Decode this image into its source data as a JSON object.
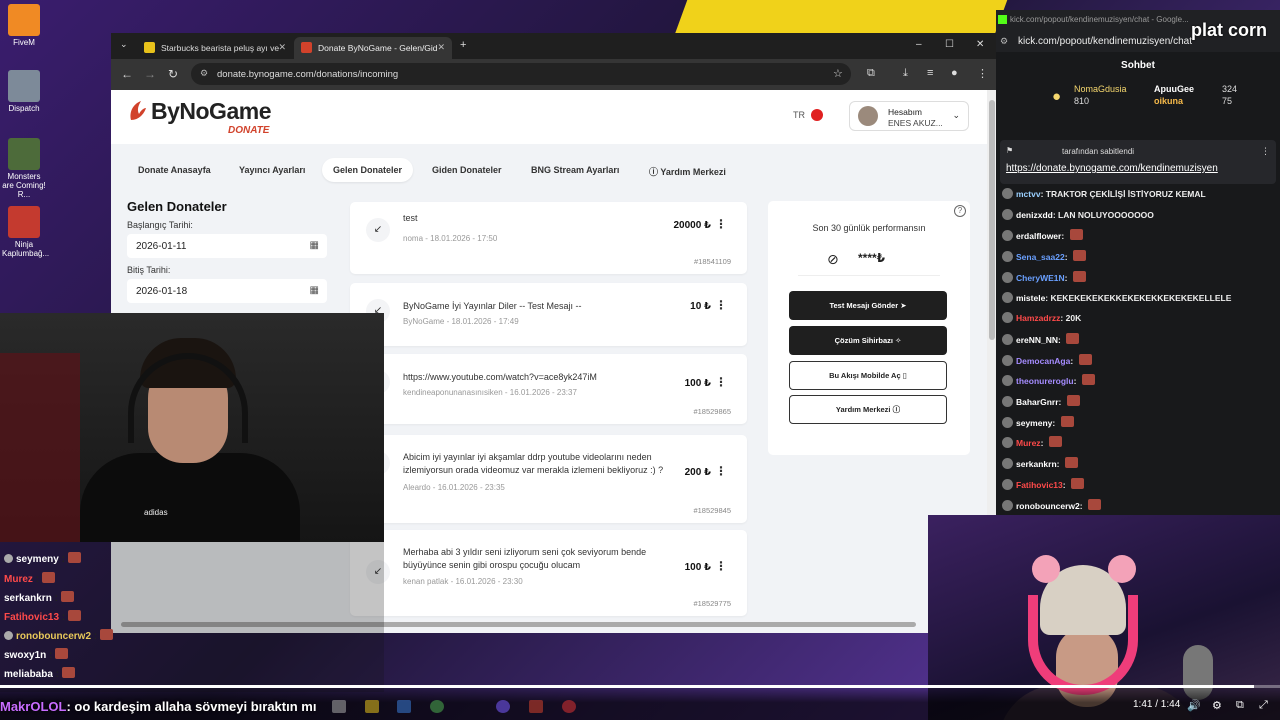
{
  "desktop": {
    "icons": [
      {
        "label": "FiveM",
        "color": "#f08a24"
      },
      {
        "label": "Dispatch",
        "color": "#7d8a99"
      },
      {
        "label": "Monsters are Coming! R...",
        "color": "#4d6b3a"
      },
      {
        "label": "Ninja Kaplumbağ...",
        "color": "#c43a2f"
      }
    ]
  },
  "browser": {
    "tabs": [
      {
        "label": "Starbucks bearista peluş ayı ve",
        "icon": "starbucks-favicon",
        "color": "#e8c21b"
      },
      {
        "label": "Donate ByNoGame - Gelen/Gid",
        "icon": "bynogame-favicon",
        "color": "#d1422b"
      }
    ],
    "url": "donate.bynogame.com/donations/incoming"
  },
  "site": {
    "logo": {
      "name": "ByNoGame",
      "sub": "DONATE"
    },
    "lang": "TR",
    "account": {
      "title": "Hesabım",
      "user": "ENES AKUZ..."
    },
    "nav": [
      {
        "label": "Donate Anasayfa",
        "active": false
      },
      {
        "label": "Yayıncı Ayarları",
        "active": false
      },
      {
        "label": "Gelen Donateler",
        "active": true
      },
      {
        "label": "Giden Donateler",
        "active": false
      },
      {
        "label": "BNG Stream Ayarları",
        "active": false
      },
      {
        "label": "Yardım Merkezi",
        "active": false
      }
    ],
    "filter": {
      "title": "Gelen Donateler",
      "start_label": "Başlangıç Tarihi:",
      "start_value": "2026-01-11",
      "end_label": "Bitiş Tarihi:",
      "end_value": "2026-01-18"
    },
    "donations": [
      {
        "message": "test",
        "sender": "noma",
        "date": "18.01.2026 - 17:50",
        "amount": "20000 ₺",
        "id": "#18541109"
      },
      {
        "message": "ByNoGame İyi Yayınlar Diler -- Test Mesajı --",
        "sender": "ByNoGame",
        "date": "18.01.2026 - 17:49",
        "amount": "10 ₺",
        "id": ""
      },
      {
        "message": "https://www.youtube.com/watch?v=ace8yk247iM",
        "sender": "kendineaponunanasınısiken",
        "date": "16.01.2026 - 23:37",
        "amount": "100 ₺",
        "id": "#18529865"
      },
      {
        "message": "Abicim iyi yayınlar iyi akşamlar ddrp youtube videolarını neden izlemiyorsun orada videomuz var merakla izlemeni bekliyoruz :) ?",
        "sender": "Aleardo",
        "date": "16.01.2026 - 23:35",
        "amount": "200 ₺",
        "id": "#18529845"
      },
      {
        "message": "Merhaba abi 3 yıldır seni izliyorum seni çok seviyorum bende büyüyünce senin gibi orospu çocuğu olucam",
        "sender": "kenan patlak",
        "date": "16.01.2026 - 23:30",
        "amount": "100 ₺",
        "id": "#18529775"
      }
    ],
    "performance": {
      "title": "Son 30 günlük performansın",
      "hidden_value": "****₺",
      "buttons": [
        {
          "label": "Test Mesajı Gönder",
          "icon": "send-icon",
          "style": "dark"
        },
        {
          "label": "Çözüm Sihirbazı",
          "icon": "magic-icon",
          "style": "dark"
        },
        {
          "label": "Bu Akışı Mobilde Aç",
          "icon": "phone-icon",
          "style": "light"
        },
        {
          "label": "Yardım Merkezi",
          "icon": "help-icon",
          "style": "light"
        }
      ]
    }
  },
  "webcam1": {
    "shirt_brand": "adidas"
  },
  "overlay_chat": [
    {
      "name": "seymeny",
      "color": "#ffffff",
      "text": ":"
    },
    {
      "name": "Murez",
      "color": "#ff4a4a",
      "text": ":"
    },
    {
      "name": "serkankrn",
      "color": "#ffffff",
      "text": ":"
    },
    {
      "name": "Fatihovic13",
      "color": "#ff4a4a",
      "text": ":"
    },
    {
      "name": "ronobouncerw2",
      "color": "#e8c85a",
      "text": ":"
    },
    {
      "name": "swoxy1n",
      "color": "#ffffff",
      "text": ":"
    },
    {
      "name": "meliababa",
      "color": "#ffffff",
      "text": ":"
    }
  ],
  "kick": {
    "tab_title": "kick.com/popout/kendinemuzisyen/chat - Google...",
    "url": "kick.com/popout/kendinemuzisyen/chat",
    "watermark": "plat corn",
    "heading": "Sohbet",
    "top_gifters": [
      {
        "name": "NomaGdusia",
        "value": "810"
      },
      {
        "name": "ApuuGee",
        "value": "324"
      },
      {
        "name": "oikuna",
        "value": "75"
      }
    ],
    "pinned": {
      "by": "tarafından sabitlendi",
      "link": "https://donate.bynogame.com/kendinemuzisyen"
    },
    "messages": [
      {
        "name": "mctvv",
        "color": "#9ad0ff",
        "text": "TRAKTOR ÇEKİLİŞİ İSTİYORUZ KEMAL"
      },
      {
        "name": "denizxdd",
        "color": "#ffffff",
        "text": "LAN NOLUYOOOOOOO"
      },
      {
        "name": "erdalflower",
        "color": "#ffffff",
        "text": ""
      },
      {
        "name": "Sena_saa22",
        "color": "#6aa0ff",
        "text": ""
      },
      {
        "name": "CheryWE1N",
        "color": "#6aa0ff",
        "text": ""
      },
      {
        "name": "mistele",
        "color": "#ffffff",
        "text": "KEKEKEKEKEKKEKEKEKKEKEKEKELLELE"
      },
      {
        "name": "Hamzadrzz",
        "color": "#ff4a4a",
        "text": "20K"
      },
      {
        "name": "ereNN_NN",
        "color": "#ffffff",
        "text": ""
      },
      {
        "name": "DemocanAga",
        "color": "#a58cff",
        "text": ""
      },
      {
        "name": "theonureroglu",
        "color": "#a58cff",
        "text": ""
      },
      {
        "name": "BaharGnrr",
        "color": "#ffffff",
        "text": ""
      },
      {
        "name": "seymeny",
        "color": "#ffffff",
        "text": ""
      },
      {
        "name": "Murez",
        "color": "#ff4a4a",
        "text": ""
      },
      {
        "name": "serkankrn",
        "color": "#ffffff",
        "text": ""
      },
      {
        "name": "Fatihovic13",
        "color": "#ff4a4a",
        "text": ""
      },
      {
        "name": "ronobouncerw2",
        "color": "#ffffff",
        "text": ""
      }
    ]
  },
  "player": {
    "subtitle_name": "MakrOLOL",
    "subtitle_text": ": oo kardeşim allaha sövmeyi bıraktın mı",
    "time": "1:41 / 1:44",
    "progress": 0.98
  }
}
